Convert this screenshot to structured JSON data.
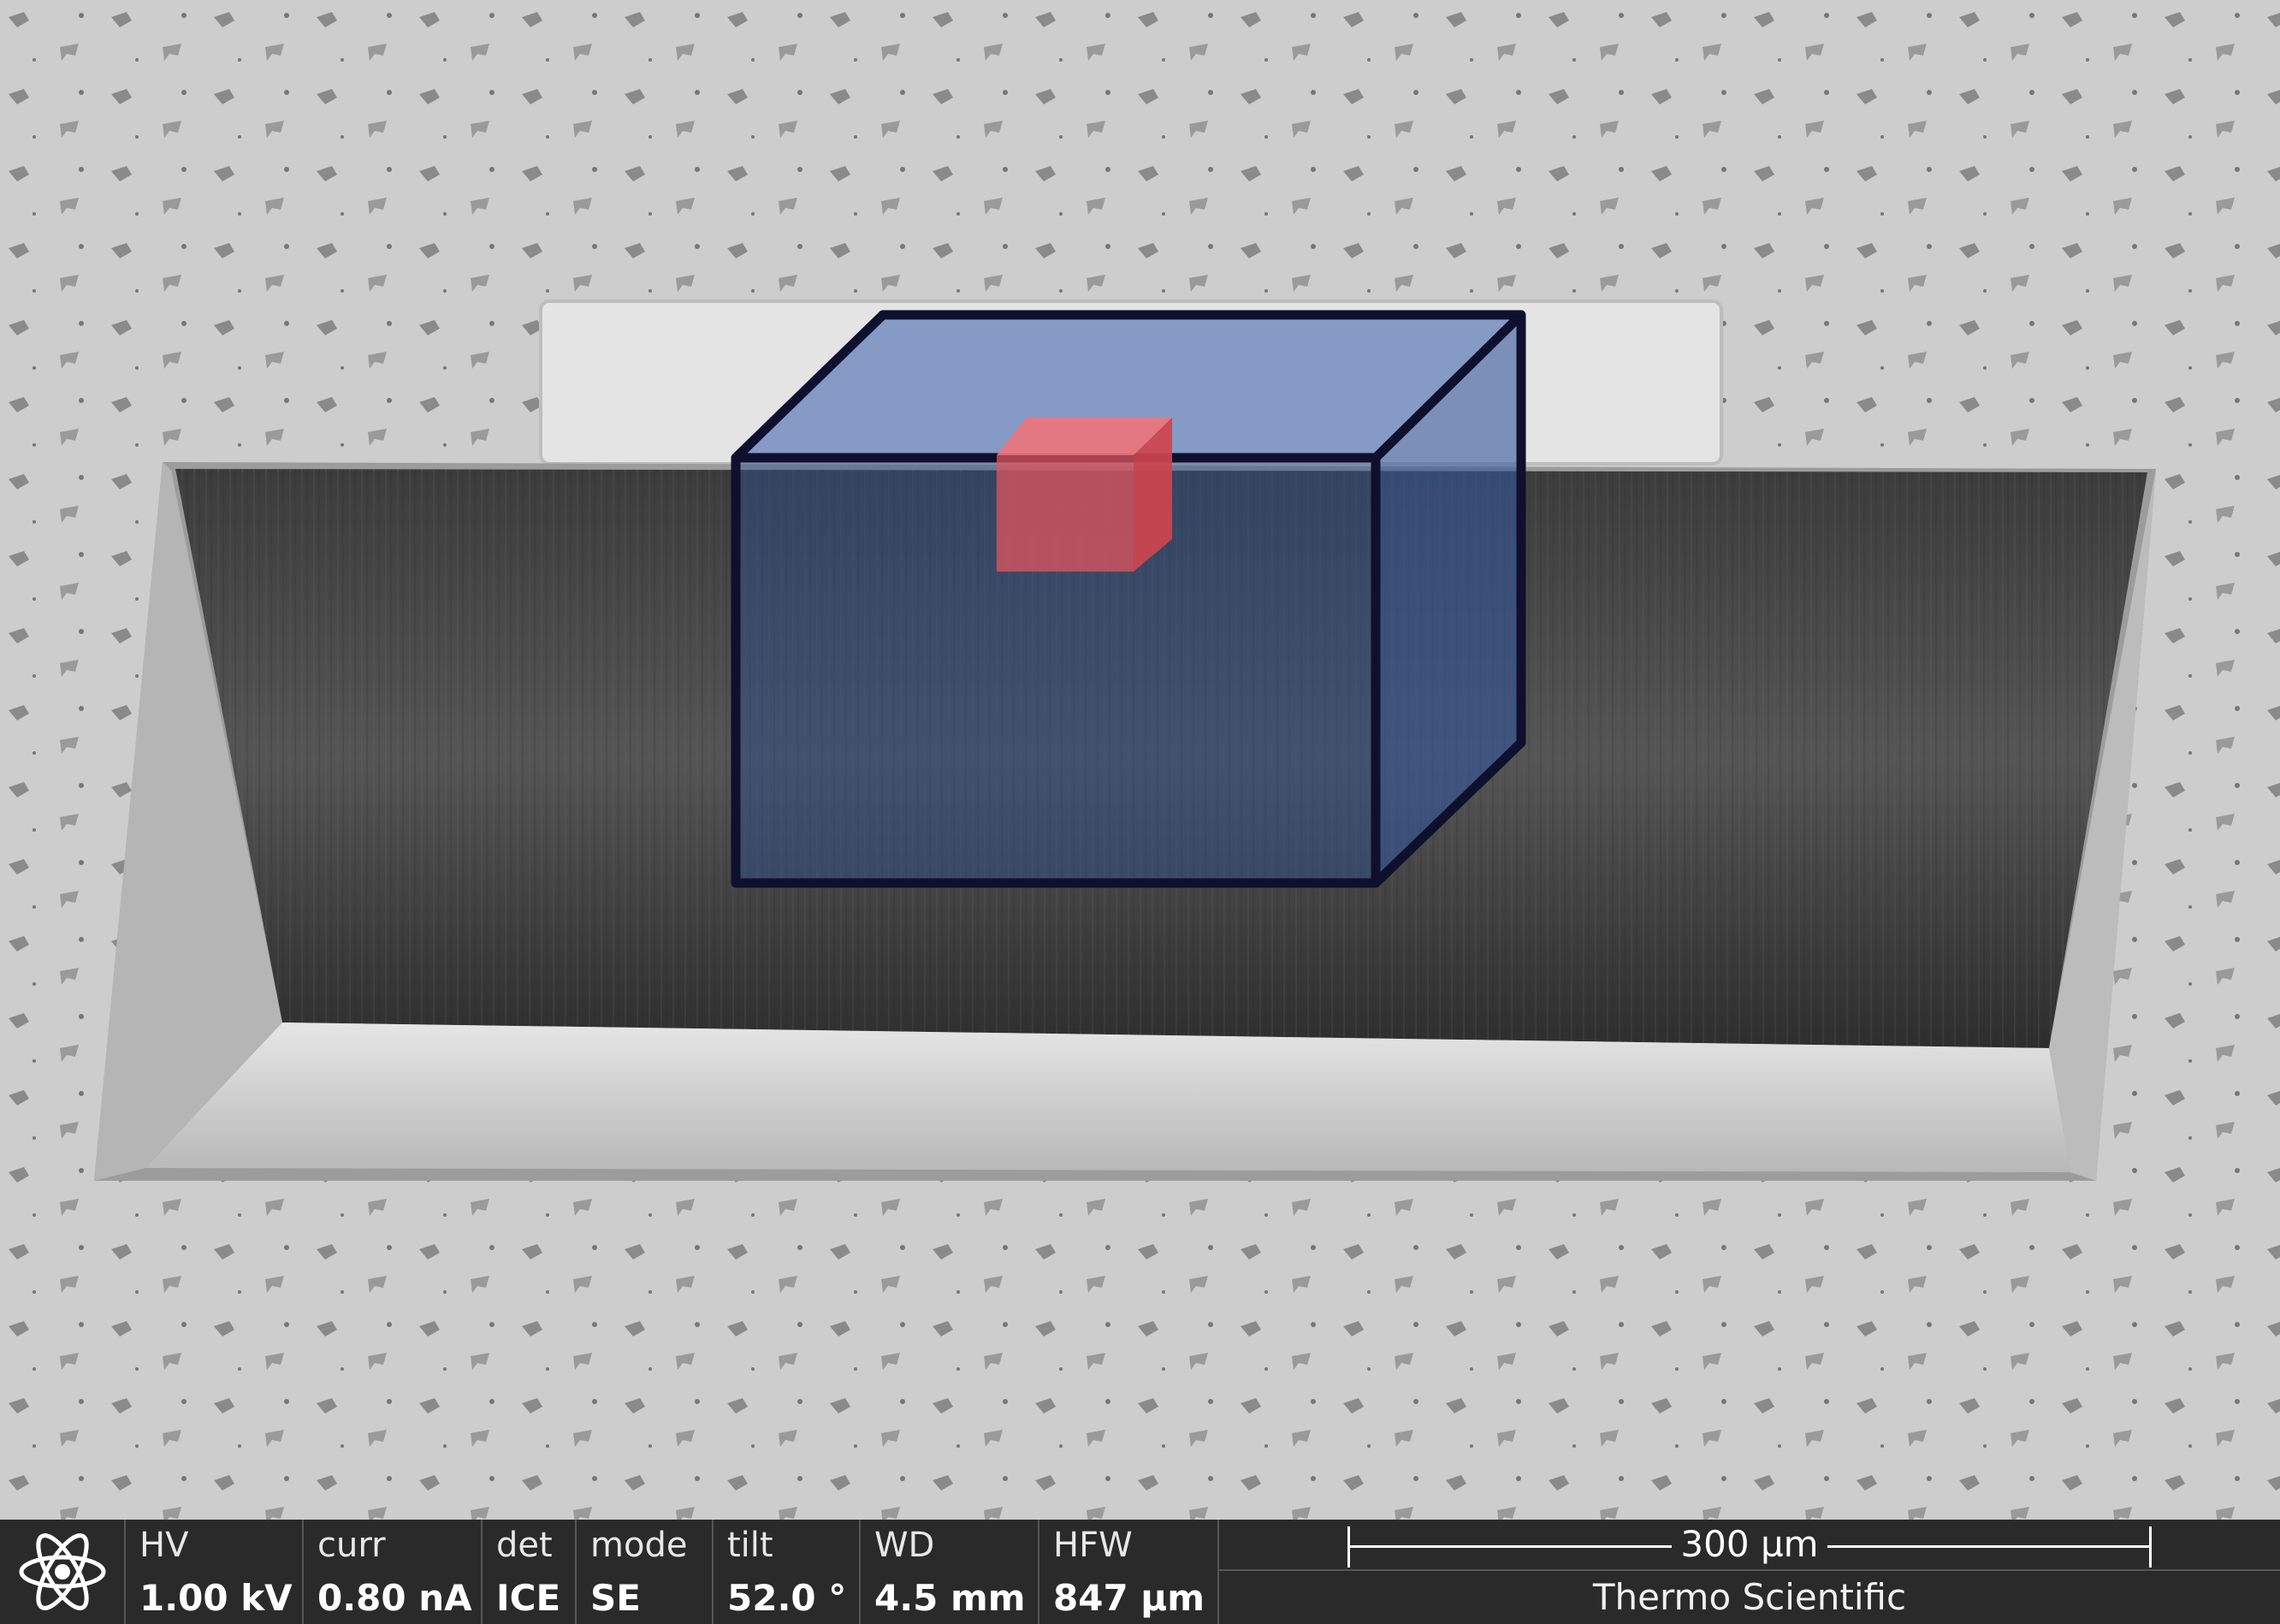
{
  "image": {
    "description_colors": {
      "surface": "#cfcfcf",
      "trench": "#4a4a4a",
      "ledge": "#d8d8d8",
      "cap": "#e8e8e8",
      "box_fill": "#2d4d8f",
      "box_stroke": "#0f0f2e",
      "cube_fill": "#e0545e"
    }
  },
  "databar": {
    "logo_icon": "atom-icon",
    "fields": [
      {
        "label": "HV",
        "value": "1.00 kV"
      },
      {
        "label": "curr",
        "value": "0.80 nA"
      },
      {
        "label": "det",
        "value": "ICE"
      },
      {
        "label": "mode",
        "value": "SE"
      },
      {
        "label": "tilt",
        "value": "52.0 °"
      },
      {
        "label": "WD",
        "value": "4.5 mm"
      },
      {
        "label": "HFW",
        "value": "847 µm"
      }
    ],
    "scale_bar": "300 µm",
    "vendor": "Thermo Scientific"
  }
}
